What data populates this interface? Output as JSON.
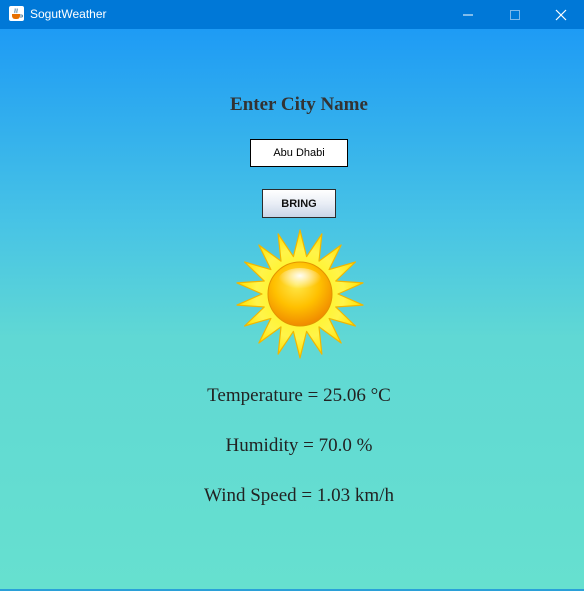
{
  "window": {
    "title": "SogutWeather",
    "icon": "java-cup-icon",
    "controls": [
      "minimize-icon",
      "maximize-icon",
      "close-icon"
    ]
  },
  "form": {
    "heading": "Enter City Name",
    "city_value": "Abu Dhabi",
    "bring_label": "BRING"
  },
  "weather": {
    "icon": "sun-icon",
    "temperature": "Temperature = 25.06 °C",
    "humidity": "Humidity = 70.0 %",
    "wind_speed": "Wind Speed = 1.03 km/h"
  },
  "colors": {
    "titlebar": "#0078d7",
    "gradient_top": "#1e9bf5",
    "gradient_bottom": "#66e0cf",
    "text": "#222222"
  }
}
